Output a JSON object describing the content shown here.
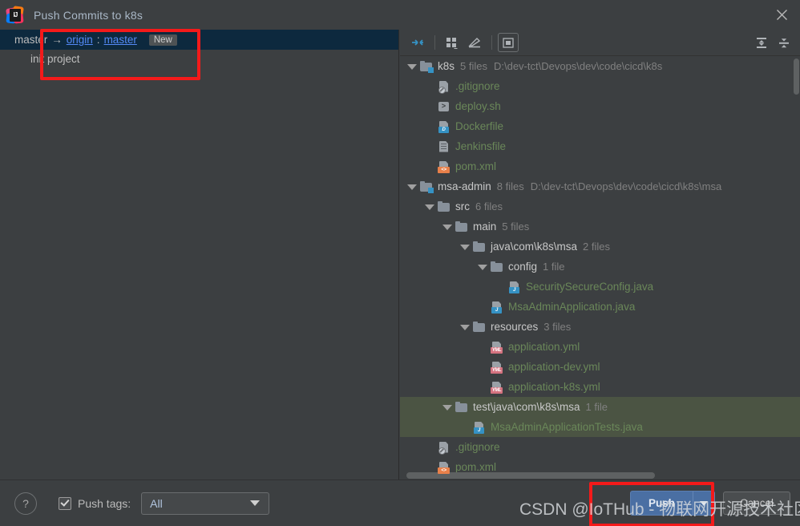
{
  "window": {
    "title": "Push Commits to k8s",
    "app_icon": "intellij-idea-icon",
    "close_icon": "close-icon"
  },
  "commit_panel": {
    "branch_row": {
      "local_branch": "master",
      "arrow": "→",
      "remote": "origin",
      "colon": ":",
      "remote_branch": "master",
      "badge": "New"
    },
    "commits": [
      {
        "message": "init project"
      }
    ]
  },
  "tree_toolbar": {
    "buttons": [
      {
        "name": "expand-changes-icon",
        "label": ""
      },
      {
        "name": "group-by-icon",
        "label": ""
      },
      {
        "name": "edit-icon",
        "label": ""
      },
      {
        "name": "preview-diff-icon",
        "label": ""
      }
    ],
    "right_buttons": [
      {
        "name": "expand-all-icon",
        "label": ""
      },
      {
        "name": "collapse-all-icon",
        "label": ""
      }
    ]
  },
  "tree": {
    "nodes": [
      {
        "id": "k8s",
        "indent": 0,
        "twisty": "open",
        "icon": "module-folder-icon",
        "kind": "folder",
        "name": "k8s",
        "meta": "5 files",
        "path": "D:\\dev-tct\\Devops\\dev\\code\\cicd\\k8s",
        "selected": false
      },
      {
        "id": "gitignore1",
        "indent": 1,
        "twisty": "none",
        "icon": "gitignore-file-icon",
        "kind": "file",
        "name": ".gitignore",
        "meta": "",
        "path": "",
        "selected": false
      },
      {
        "id": "deploysh",
        "indent": 1,
        "twisty": "none",
        "icon": "shell-script-icon",
        "kind": "file",
        "name": "deploy.sh",
        "meta": "",
        "path": "",
        "selected": false
      },
      {
        "id": "dockerfile",
        "indent": 1,
        "twisty": "none",
        "icon": "dockerfile-icon",
        "kind": "file",
        "name": "Dockerfile",
        "meta": "",
        "path": "",
        "selected": false
      },
      {
        "id": "jenkinsfile",
        "indent": 1,
        "twisty": "none",
        "icon": "jenkinsfile-icon",
        "kind": "file",
        "name": "Jenkinsfile",
        "meta": "",
        "path": "",
        "selected": false
      },
      {
        "id": "pomxml1",
        "indent": 1,
        "twisty": "none",
        "icon": "xml-file-icon",
        "kind": "file",
        "name": "pom.xml",
        "meta": "",
        "path": "",
        "selected": false
      },
      {
        "id": "msaadmin",
        "indent": 0,
        "twisty": "open",
        "icon": "module-folder-icon",
        "kind": "folder",
        "name": "msa-admin",
        "meta": "8 files",
        "path": "D:\\dev-tct\\Devops\\dev\\code\\cicd\\k8s\\msa",
        "selected": false
      },
      {
        "id": "src",
        "indent": 1,
        "twisty": "open",
        "icon": "folder-icon",
        "kind": "folder",
        "name": "src",
        "meta": "6 files",
        "path": "",
        "selected": false
      },
      {
        "id": "main",
        "indent": 2,
        "twisty": "open",
        "icon": "folder-icon",
        "kind": "folder",
        "name": "main",
        "meta": "5 files",
        "path": "",
        "selected": false
      },
      {
        "id": "javapkg",
        "indent": 3,
        "twisty": "open",
        "icon": "folder-icon",
        "kind": "folder",
        "name": "java\\com\\k8s\\msa",
        "meta": "2 files",
        "path": "",
        "selected": false
      },
      {
        "id": "config",
        "indent": 4,
        "twisty": "open",
        "icon": "folder-icon",
        "kind": "folder",
        "name": "config",
        "meta": "1 file",
        "path": "",
        "selected": false
      },
      {
        "id": "secconfig",
        "indent": 5,
        "twisty": "none",
        "icon": "java-file-icon",
        "kind": "file",
        "name": "SecuritySecureConfig.java",
        "meta": "",
        "path": "",
        "selected": false
      },
      {
        "id": "msaapp",
        "indent": 4,
        "twisty": "none",
        "icon": "java-file-icon",
        "kind": "file",
        "name": "MsaAdminApplication.java",
        "meta": "",
        "path": "",
        "selected": false
      },
      {
        "id": "resources",
        "indent": 3,
        "twisty": "open",
        "icon": "folder-icon",
        "kind": "folder",
        "name": "resources",
        "meta": "3 files",
        "path": "",
        "selected": false
      },
      {
        "id": "appyml",
        "indent": 4,
        "twisty": "none",
        "icon": "yml-file-icon",
        "kind": "file",
        "name": "application.yml",
        "meta": "",
        "path": "",
        "selected": false
      },
      {
        "id": "appdevyml",
        "indent": 4,
        "twisty": "none",
        "icon": "yml-file-icon",
        "kind": "file",
        "name": "application-dev.yml",
        "meta": "",
        "path": "",
        "selected": false
      },
      {
        "id": "appk8syml",
        "indent": 4,
        "twisty": "none",
        "icon": "yml-file-icon",
        "kind": "file",
        "name": "application-k8s.yml",
        "meta": "",
        "path": "",
        "selected": false
      },
      {
        "id": "testpkg",
        "indent": 2,
        "twisty": "open",
        "icon": "folder-icon",
        "kind": "folder",
        "name": "test\\java\\com\\k8s\\msa",
        "meta": "1 file",
        "path": "",
        "selected": true
      },
      {
        "id": "msatests",
        "indent": 3,
        "twisty": "none",
        "icon": "java-file-icon",
        "kind": "file",
        "name": "MsaAdminApplicationTests.java",
        "meta": "",
        "path": "",
        "selected": true
      },
      {
        "id": "gitignore2",
        "indent": 1,
        "twisty": "none",
        "icon": "gitignore-file-icon",
        "kind": "file",
        "name": ".gitignore",
        "meta": "",
        "path": "",
        "selected": false
      },
      {
        "id": "pomxml2",
        "indent": 1,
        "twisty": "none",
        "icon": "xml-file-icon",
        "kind": "file",
        "name": "pom.xml",
        "meta": "",
        "path": "",
        "selected": false
      }
    ]
  },
  "bottom_bar": {
    "help_label": "?",
    "push_tags_label": "Push tags:",
    "push_tags_checked": true,
    "tags_value": "All",
    "push_label": "Push",
    "cancel_label": "Cancel"
  },
  "annotations": {
    "watermark": "CSDN @IoTHub - 物联网开源技术社区",
    "accent_red": "#f41a1a"
  }
}
